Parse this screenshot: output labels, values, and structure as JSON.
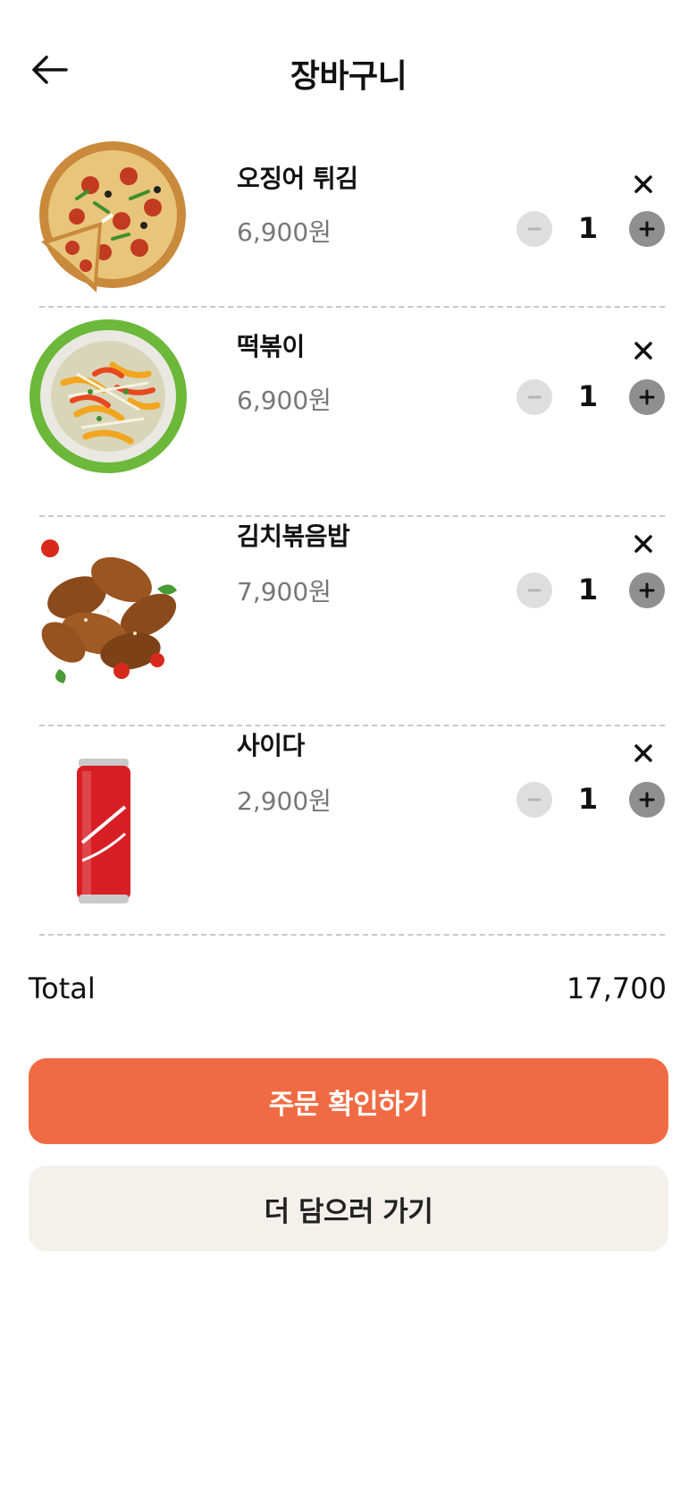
{
  "header": {
    "title": "장바구니"
  },
  "colors": {
    "accent": "#f06b43",
    "secondary_button_bg": "#f4f0ec",
    "price_text": "#777777"
  },
  "cart": {
    "items": [
      {
        "name": "오징어 튀김",
        "price": "6,900원",
        "quantity": "1",
        "image": "pizza"
      },
      {
        "name": "떡볶이",
        "price": "6,900원",
        "quantity": "1",
        "image": "salad"
      },
      {
        "name": "김치볶음밥",
        "price": "7,900원",
        "quantity": "1",
        "image": "chicken-wings"
      },
      {
        "name": "사이다",
        "price": "2,900원",
        "quantity": "1",
        "image": "cola-can"
      }
    ]
  },
  "summary": {
    "total_label": "Total",
    "total_value": "17,700"
  },
  "actions": {
    "confirm_label": "주문 확인하기",
    "more_label": "더 담으러 가기"
  }
}
